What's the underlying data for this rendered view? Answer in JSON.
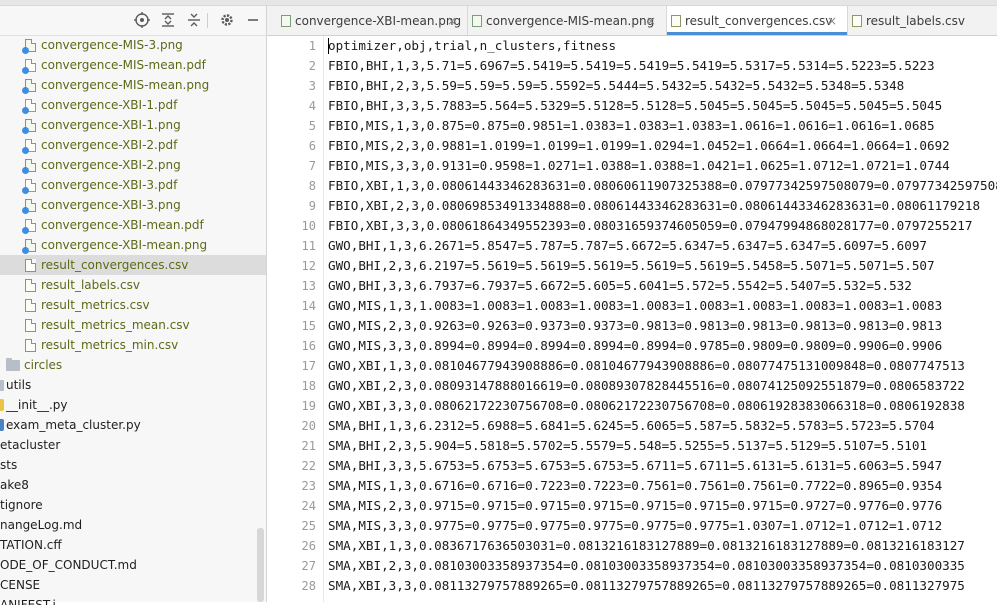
{
  "tree": {
    "items": [
      {
        "label": "convergence-MIS-3.png",
        "type": "png",
        "indent": 1
      },
      {
        "label": "convergence-MIS-mean.pdf",
        "type": "pdf",
        "indent": 1
      },
      {
        "label": "convergence-MIS-mean.png",
        "type": "png",
        "indent": 1
      },
      {
        "label": "convergence-XBI-1.pdf",
        "type": "pdf",
        "indent": 1
      },
      {
        "label": "convergence-XBI-1.png",
        "type": "png",
        "indent": 1
      },
      {
        "label": "convergence-XBI-2.pdf",
        "type": "pdf",
        "indent": 1
      },
      {
        "label": "convergence-XBI-2.png",
        "type": "png",
        "indent": 1
      },
      {
        "label": "convergence-XBI-3.pdf",
        "type": "pdf",
        "indent": 1
      },
      {
        "label": "convergence-XBI-3.png",
        "type": "png",
        "indent": 1
      },
      {
        "label": "convergence-XBI-mean.pdf",
        "type": "pdf",
        "indent": 1
      },
      {
        "label": "convergence-XBI-mean.png",
        "type": "png",
        "indent": 1
      },
      {
        "label": "result_convergences.csv",
        "type": "csv",
        "indent": 1,
        "selected": true
      },
      {
        "label": "result_labels.csv",
        "type": "csv",
        "indent": 1
      },
      {
        "label": "result_metrics.csv",
        "type": "csv",
        "indent": 1
      },
      {
        "label": "result_metrics_mean.csv",
        "type": "csv",
        "indent": 1
      },
      {
        "label": "result_metrics_min.csv",
        "type": "csv",
        "indent": 1
      },
      {
        "label": "circles",
        "type": "folder",
        "indent": 0
      },
      {
        "label": "utils",
        "type": "folderpartial",
        "indent": -1
      },
      {
        "label": "__init__.py",
        "type": "py",
        "indent": -1
      },
      {
        "label": "exam_meta_cluster.py",
        "type": "pyblue",
        "indent": -1
      },
      {
        "label": "etacluster",
        "type": "text",
        "indent": -2
      },
      {
        "label": "sts",
        "type": "text",
        "indent": -2
      },
      {
        "label": "ake8",
        "type": "text",
        "indent": -2
      },
      {
        "label": "tignore",
        "type": "text",
        "indent": -2
      },
      {
        "label": "nangeLog.md",
        "type": "text",
        "indent": -2
      },
      {
        "label": "TATION.cff",
        "type": "text",
        "indent": -2
      },
      {
        "label": "ODE_OF_CONDUCT.md",
        "type": "text",
        "indent": -2
      },
      {
        "label": "CENSE",
        "type": "text",
        "indent": -2
      },
      {
        "label": "ANIFEST.i",
        "type": "text",
        "indent": -2
      }
    ]
  },
  "tabs": [
    {
      "label": "convergence-XBI-mean.png",
      "icon": "png",
      "active": false
    },
    {
      "label": "convergence-MIS-mean.png",
      "icon": "png",
      "active": false
    },
    {
      "label": "result_convergences.csv",
      "icon": "csv",
      "active": true
    },
    {
      "label": "result_labels.csv",
      "icon": "csv",
      "active": false
    }
  ],
  "close_glyph": "×",
  "lines": [
    "optimizer,obj,trial,n_clusters,fitness",
    "FBIO,BHI,1,3,5.71=5.6967=5.5419=5.5419=5.5419=5.5419=5.5317=5.5314=5.5223=5.5223",
    "FBIO,BHI,2,3,5.59=5.59=5.59=5.5592=5.5444=5.5432=5.5432=5.5432=5.5348=5.5348",
    "FBIO,BHI,3,3,5.7883=5.564=5.5329=5.5128=5.5128=5.5045=5.5045=5.5045=5.5045=5.5045",
    "FBIO,MIS,1,3,0.875=0.875=0.9851=1.0383=1.0383=1.0383=1.0616=1.0616=1.0616=1.0685",
    "FBIO,MIS,2,3,0.9881=1.0199=1.0199=1.0199=1.0294=1.0452=1.0664=1.0664=1.0664=1.0692",
    "FBIO,MIS,3,3,0.9131=0.9598=1.0271=1.0388=1.0388=1.0421=1.0625=1.0712=1.0721=1.0744",
    "FBIO,XBI,1,3,0.08061443346283631=0.08060611907325388=0.07977342597508079=0.07977342597508079",
    "FBIO,XBI,2,3,0.08069853491334888=0.08061443346283631=0.08061443346283631=0.08061179218",
    "FBIO,XBI,3,3,0.08061864349552393=0.08031659374605059=0.07947994868028177=0.0797255217",
    "GWO,BHI,1,3,6.2671=5.8547=5.787=5.787=5.6672=5.6347=5.6347=5.6347=5.6097=5.6097",
    "GWO,BHI,2,3,6.2197=5.5619=5.5619=5.5619=5.5619=5.5619=5.5458=5.5071=5.5071=5.507",
    "GWO,BHI,3,3,6.7937=6.7937=5.6672=5.605=5.6041=5.572=5.5542=5.5407=5.532=5.532",
    "GWO,MIS,1,3,1.0083=1.0083=1.0083=1.0083=1.0083=1.0083=1.0083=1.0083=1.0083=1.0083",
    "GWO,MIS,2,3,0.9263=0.9263=0.9373=0.9373=0.9813=0.9813=0.9813=0.9813=0.9813=0.9813",
    "GWO,MIS,3,3,0.8994=0.8994=0.8994=0.8994=0.8994=0.9785=0.9809=0.9809=0.9906=0.9906",
    "GWO,XBI,1,3,0.08104677943908886=0.08104677943908886=0.08077475131009848=0.0807747513",
    "GWO,XBI,2,3,0.08093147888016619=0.08089307828445516=0.08074125092551879=0.0806583722",
    "GWO,XBI,3,3,0.08062172230756708=0.08062172230756708=0.08061928383066318=0.0806192838",
    "SMA,BHI,1,3,6.2312=5.6988=5.6841=5.6245=5.6065=5.587=5.5832=5.5783=5.5723=5.5704",
    "SMA,BHI,2,3,5.904=5.5818=5.5702=5.5579=5.548=5.5255=5.5137=5.5129=5.5107=5.5101",
    "SMA,BHI,3,3,5.6753=5.6753=5.6753=5.6753=5.6711=5.6711=5.6131=5.6131=5.6063=5.5947",
    "SMA,MIS,1,3,0.6716=0.6716=0.7223=0.7223=0.7561=0.7561=0.7561=0.7722=0.8965=0.9354",
    "SMA,MIS,2,3,0.9715=0.9715=0.9715=0.9715=0.9715=0.9715=0.9715=0.9727=0.9776=0.9776",
    "SMA,MIS,3,3,0.9775=0.9775=0.9775=0.9775=0.9775=0.9775=1.0307=1.0712=1.0712=1.0712",
    "SMA,XBI,1,3,0.0836717636503031=0.0813216183127889=0.0813216183127889=0.0813216183127",
    "SMA,XBI,2,3,0.08103003358937354=0.08103003358937354=0.08103003358937354=0.0810300335",
    "SMA,XBI,3,3,0.08113279757889265=0.08113279757889265=0.08113279757889265=0.0811327975"
  ]
}
